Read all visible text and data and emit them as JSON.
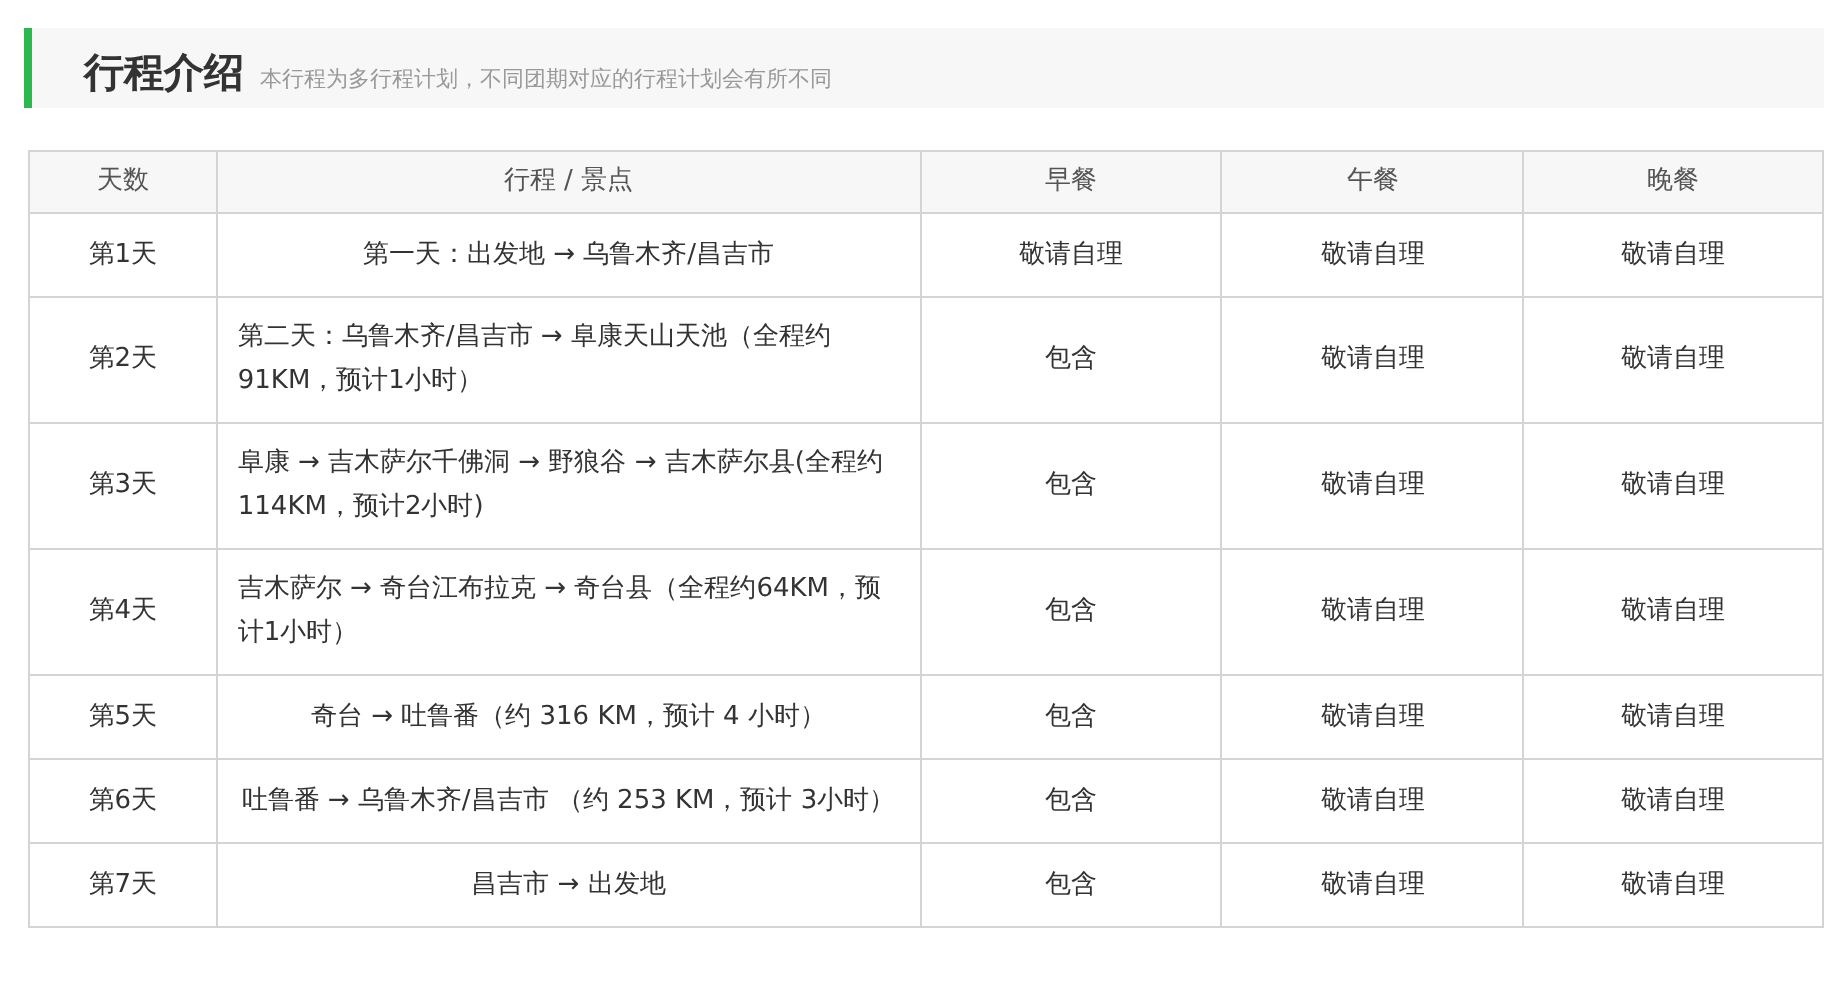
{
  "section": {
    "title": "行程介绍",
    "subtitle": "本行程为多行程计划，不同团期对应的行程计划会有所不同"
  },
  "table": {
    "columns": [
      "天数",
      "行程 / 景点",
      "早餐",
      "午餐",
      "晚餐"
    ],
    "rows": [
      {
        "day": "第1天",
        "route": "第一天：出发地 → 乌鲁木齐/昌吉市",
        "breakfast": "敬请自理",
        "lunch": "敬请自理",
        "dinner": "敬请自理"
      },
      {
        "day": "第2天",
        "route": "第二天：乌鲁木齐/昌吉市 → 阜康天山天池（全程约91KM，预计1小时）",
        "breakfast": "包含",
        "lunch": "敬请自理",
        "dinner": "敬请自理"
      },
      {
        "day": "第3天",
        "route": "阜康 → 吉木萨尔千佛洞 → 野狼谷 → 吉木萨尔县(全程约114KM，预计2小时)",
        "breakfast": "包含",
        "lunch": "敬请自理",
        "dinner": "敬请自理"
      },
      {
        "day": "第4天",
        "route": "吉木萨尔 → 奇台江布拉克 → 奇台县（全程约64KM，预计1小时）",
        "breakfast": "包含",
        "lunch": "敬请自理",
        "dinner": "敬请自理"
      },
      {
        "day": "第5天",
        "route": "奇台 → 吐鲁番（约 316 KM，预计 4 小时）",
        "breakfast": "包含",
        "lunch": "敬请自理",
        "dinner": "敬请自理"
      },
      {
        "day": "第6天",
        "route": "吐鲁番 → 乌鲁木齐/昌吉市 （约 253 KM，预计 3小时）",
        "breakfast": "包含",
        "lunch": "敬请自理",
        "dinner": "敬请自理"
      },
      {
        "day": "第7天",
        "route": "昌吉市 → 出发地",
        "breakfast": "包含",
        "lunch": "敬请自理",
        "dinner": "敬请自理"
      }
    ]
  }
}
